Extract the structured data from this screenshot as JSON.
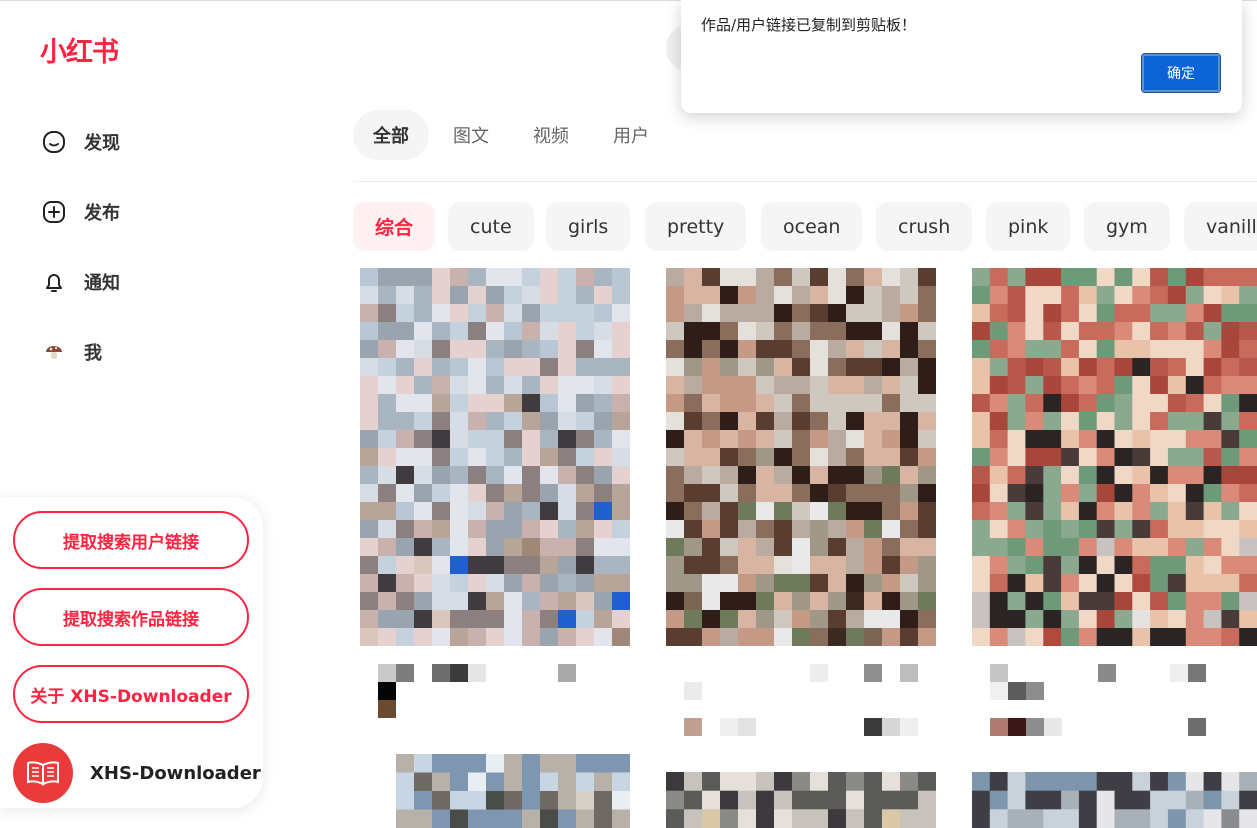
{
  "app": {
    "logo": "小红书"
  },
  "sidebar": {
    "items": [
      {
        "label": "发现",
        "icon": "discover-icon"
      },
      {
        "label": "发布",
        "icon": "publish-icon"
      },
      {
        "label": "通知",
        "icon": "bell-icon"
      },
      {
        "label": "我",
        "icon": "avatar-icon"
      }
    ]
  },
  "tabs": [
    {
      "label": "全部",
      "active": true
    },
    {
      "label": "图文",
      "active": false
    },
    {
      "label": "视频",
      "active": false
    },
    {
      "label": "用户",
      "active": false
    }
  ],
  "chips": [
    {
      "label": "综合",
      "active": true
    },
    {
      "label": "cute"
    },
    {
      "label": "girls"
    },
    {
      "label": "pretty"
    },
    {
      "label": "ocean"
    },
    {
      "label": "crush"
    },
    {
      "label": "pink"
    },
    {
      "label": "gym"
    },
    {
      "label": "vanill"
    }
  ],
  "panel": {
    "btn_users": "提取搜索用户链接",
    "btn_works": "提取搜索作品链接",
    "btn_about": "关于 XHS-Downloader",
    "brand": "XHS-Downloader",
    "brand_icon": "book-icon"
  },
  "dialog": {
    "message": "作品/用户链接已复制到剪贴板！",
    "ok": "确定"
  },
  "colors": {
    "brand": "#ff2442",
    "dialog_button": "#0b63d6"
  }
}
